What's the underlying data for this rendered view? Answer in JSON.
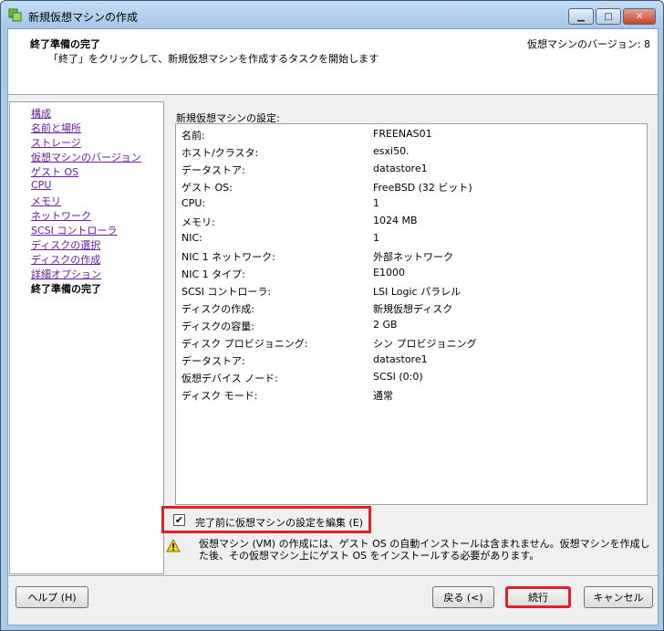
{
  "window": {
    "title": "新規仮想マシンの作成"
  },
  "header": {
    "title": "終了準備の完了",
    "subtitle": "「終了」をクリックして、新規仮想マシンを作成するタスクを開始します",
    "version": "仮想マシンのバージョン: 8"
  },
  "nav": {
    "items": [
      {
        "label": "構成"
      },
      {
        "label": "名前と場所"
      },
      {
        "label": "ストレージ"
      },
      {
        "label": "仮想マシンのバージョン"
      },
      {
        "label": "ゲスト OS"
      },
      {
        "label": "CPU"
      },
      {
        "label": "メモリ"
      },
      {
        "label": "ネットワーク"
      },
      {
        "label": "SCSI コントローラ"
      },
      {
        "label": "ディスクの選択"
      },
      {
        "label": "ディスクの作成"
      },
      {
        "label": "詳細オプション"
      },
      {
        "label": "終了準備の完了"
      }
    ]
  },
  "settings": {
    "section_label": "新規仮想マシンの設定:",
    "rows": [
      {
        "key": "名前:",
        "value": "FREENAS01"
      },
      {
        "key": "ホスト/クラスタ:",
        "value": "esxi50."
      },
      {
        "key": "データストア:",
        "value": "datastore1"
      },
      {
        "key": "ゲスト OS:",
        "value": "FreeBSD (32 ビット)"
      },
      {
        "key": "CPU:",
        "value": "1"
      },
      {
        "key": "メモリ:",
        "value": "1024 MB"
      },
      {
        "key": "NIC:",
        "value": "1"
      },
      {
        "key": "NIC 1 ネットワーク:",
        "value": "外部ネットワーク"
      },
      {
        "key": "NIC 1 タイプ:",
        "value": "E1000"
      },
      {
        "key": "SCSI コントローラ:",
        "value": "LSI Logic パラレル"
      },
      {
        "key": "ディスクの作成:",
        "value": "新規仮想ディスク"
      },
      {
        "key": "ディスクの容量:",
        "value": "2 GB"
      },
      {
        "key": "ディスク プロビジョニング:",
        "value": "シン プロビジョニング"
      },
      {
        "key": "データストア:",
        "value": "datastore1"
      },
      {
        "key": "仮想デバイス ノード:",
        "value": "SCSI (0:0)"
      },
      {
        "key": "ディスク モード:",
        "value": "通常"
      }
    ]
  },
  "edit_checkbox": {
    "checked": true,
    "label": "完了前に仮想マシンの設定を編集 (E)"
  },
  "warning": {
    "icon": "warning-icon",
    "text": "仮想マシン (VM) の作成には、ゲスト OS の自動インストールは含まれません。仮想マシンを作成した後、その仮想マシン上にゲスト OS をインストールする必要があります。"
  },
  "buttons": {
    "help": "ヘルプ (H)",
    "back": "戻る (<)",
    "next": "続行",
    "cancel": "キャンセル"
  },
  "colors": {
    "highlight": "#e0202a",
    "link": "#6a1aa8",
    "titlebar": "#aac8e8"
  }
}
